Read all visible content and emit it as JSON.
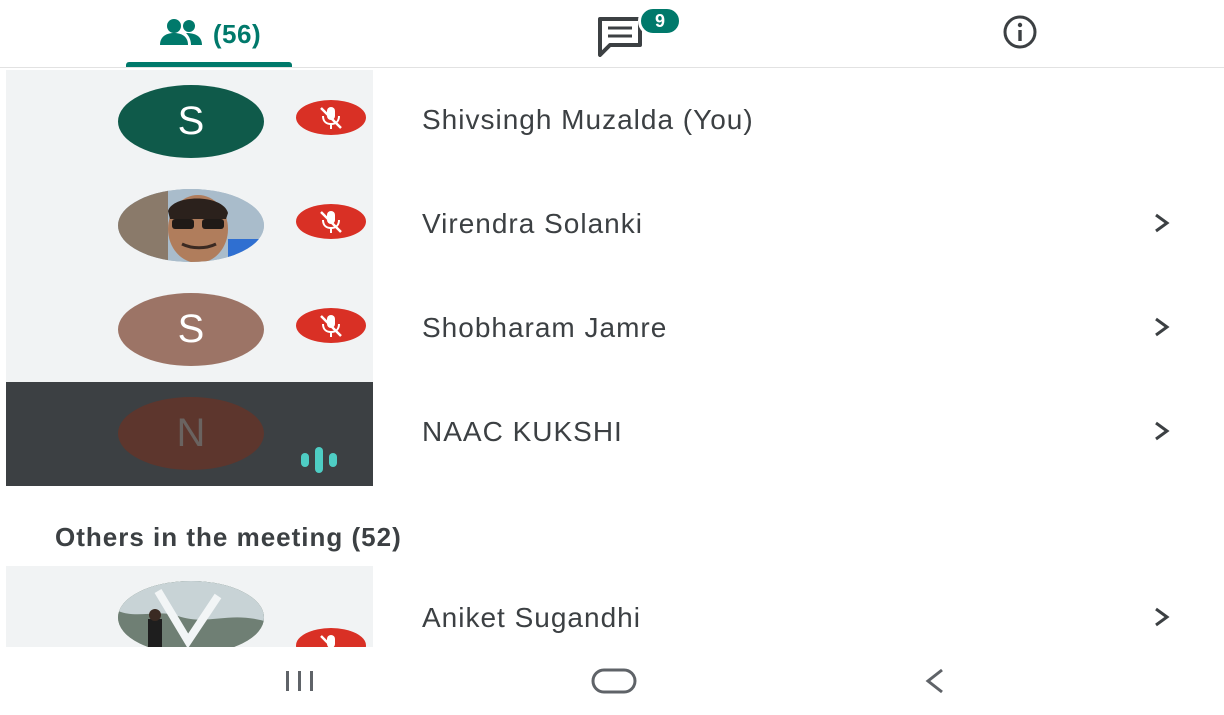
{
  "tabs": {
    "people_count": "(56)",
    "chat_badge": "9"
  },
  "participants": [
    {
      "name": "Shivsingh Muzalda (You)",
      "avatar_letter": "S",
      "avatar_color": "#0f5a4a",
      "status": "muted"
    },
    {
      "name": "Virendra Solanki",
      "avatar_letter": "",
      "avatar_color": "#6d7b85",
      "status": "muted"
    },
    {
      "name": "Shobharam Jamre",
      "avatar_letter": "S",
      "avatar_color": "#9c7466",
      "status": "muted"
    },
    {
      "name": "NAAC KUKSHI",
      "avatar_letter": "N",
      "avatar_color": "#5d362d",
      "status": "speaking"
    }
  ],
  "others_section": {
    "title": "Others in the meeting (52)",
    "participants": [
      {
        "name": "Aniket Sugandhi",
        "status": "muted"
      }
    ]
  },
  "colors": {
    "accent": "#00796b",
    "mute_red": "#d93025",
    "speaking_teal": "#4ecdc4"
  },
  "icons": {
    "people_tab": "people-icon",
    "chat_tab": "chat-icon",
    "info_tab": "info-icon",
    "mute": "mic-off-icon",
    "chevron": "chevron-right-icon",
    "nav_recents": "recents-icon",
    "nav_home": "home-icon",
    "nav_back": "back-icon"
  }
}
